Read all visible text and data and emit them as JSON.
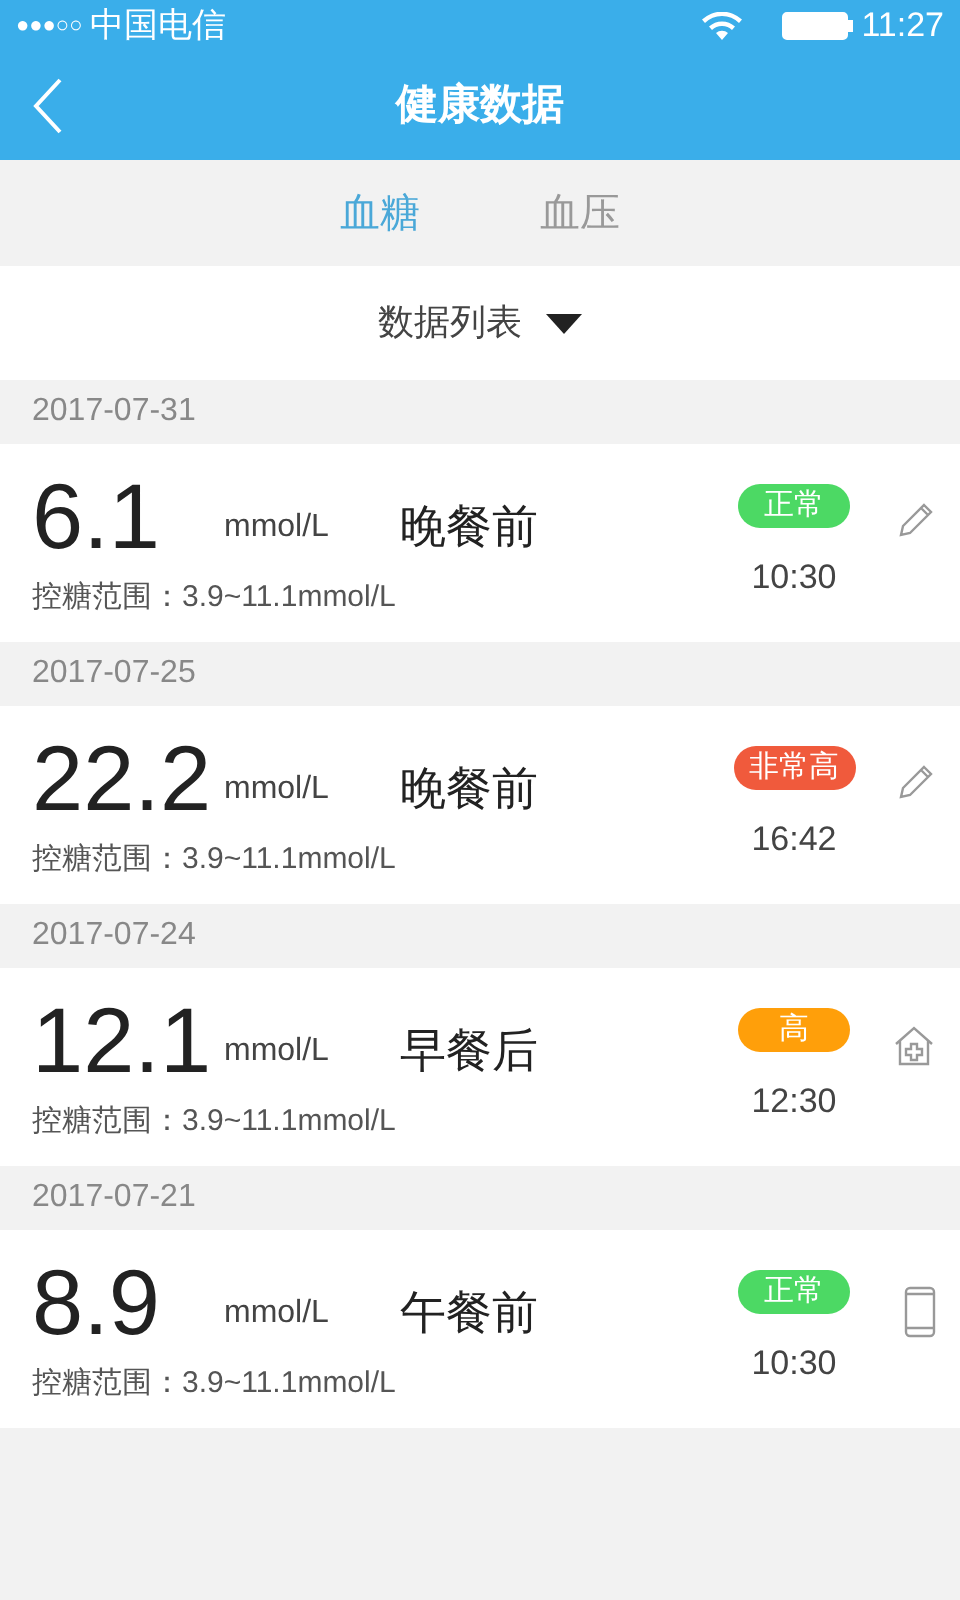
{
  "status_bar": {
    "signal_dots": "●●●○○",
    "carrier": "中国电信",
    "time": "11:27"
  },
  "header": {
    "title": "健康数据"
  },
  "tabs": [
    {
      "label": "血糖",
      "selected": true
    },
    {
      "label": "血压",
      "selected": false
    }
  ],
  "view_selector": {
    "label": "数据列表"
  },
  "records": [
    {
      "date": "2017-07-31",
      "value": "6.1",
      "unit": "mmol/L",
      "meal": "晚餐前",
      "status": "正常",
      "color": "#4cd964",
      "range_label": "控糖范围：",
      "range": "3.9~11.1mmol/L",
      "time": "10:30",
      "kind": "manual"
    },
    {
      "date": "2017-07-25",
      "value": "22.2",
      "unit": "mmol/L",
      "meal": "晚餐前",
      "status": "非常高",
      "color": "#f05a3c",
      "range_label": "控糖范围：",
      "range": "3.9~11.1mmol/L",
      "time": "16:42",
      "kind": "manual"
    },
    {
      "date": "2017-07-24",
      "value": "12.1",
      "unit": "mmol/L",
      "meal": "早餐后",
      "status": "高",
      "color": "#ff9f0a",
      "range_label": "控糖范围：",
      "range": "3.9~11.1mmol/L",
      "time": "12:30",
      "kind": "clinic"
    },
    {
      "date": "2017-07-21",
      "value": "8.9",
      "unit": "mmol/L",
      "meal": "午餐前",
      "status": "正常",
      "color": "#4cd964",
      "range_label": "控糖范围：",
      "range": "3.9~11.1mmol/L",
      "time": "10:30",
      "kind": "device"
    }
  ]
}
